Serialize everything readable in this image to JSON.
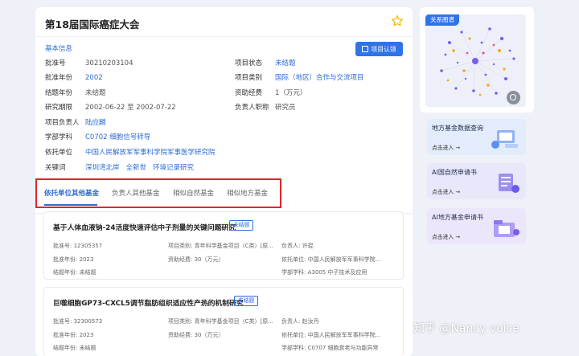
{
  "header": {
    "title": "第18届国际癌症大会"
  },
  "basic": {
    "section_title": "基本信息",
    "project_btn": "项目认领",
    "left": [
      {
        "label": "批准号",
        "value": "30210203104",
        "blue": false
      },
      {
        "label": "批准年份",
        "value": "2002",
        "blue": true
      },
      {
        "label": "结题年份",
        "value": "未结题",
        "blue": false
      },
      {
        "label": "研究期限",
        "value": "2002-06-22 至 2002-07-22",
        "blue": false
      },
      {
        "label": "项目负责人",
        "value": "陆应麟",
        "blue": true
      },
      {
        "label": "学部学科",
        "value": "C0702 细胞信号转导",
        "blue": true
      },
      {
        "label": "依托单位",
        "value": "中国人民解放军军事科学院军事医学研究院",
        "blue": true
      }
    ],
    "right": [
      {
        "label": "项目状态",
        "value": "未结题",
        "blue": true
      },
      {
        "label": "项目类别",
        "value": "国际（地区）合作与交流项目",
        "blue": true
      },
      {
        "label": "资助经费",
        "value": "1（万元）",
        "blue": false
      },
      {
        "label": "负责人职称",
        "value": "研究员",
        "blue": false
      }
    ],
    "keywords_label": "关键词",
    "keywords": [
      "深圳湾北岸",
      "全新世",
      "环境记录研究"
    ]
  },
  "tabs": [
    "依托单位其他基金",
    "负责人其他基金",
    "相似自然基金",
    "相似地方基金"
  ],
  "projects": [
    {
      "title": "基于人体血液钠-24活度快速评估中子剂量的关键问题研究",
      "badge": "未结题",
      "meta": [
        [
          "批准号: 12305357",
          "项目类别: 青年科学基金项目（C类）[原...",
          "负责人: 许琨"
        ],
        [
          "批准年份: 2023",
          "资助经费: 30（万元）",
          "依托单位: 中国人民解放军军事科学院..."
        ],
        [
          "结题年份: 未结题",
          "",
          "学部学科: A3005 中子技术及应用"
        ]
      ]
    },
    {
      "title": "巨噬细胞GP73-CXCL5调节脂肪组织适应性产热的机制研究",
      "badge": "未结题",
      "meta": [
        [
          "批准号: 32300573",
          "项目类别: 青年科学基金项目（C类）[原...",
          "负责人: 赵汝丹"
        ],
        [
          "批准年份: 2023",
          "资助经费: 30（万元）",
          "依托单位: 中国人民解放军军事科学院..."
        ],
        [
          "结题年份: 未结题",
          "",
          "学部学科: C0707 细胞衰老与功能异常"
        ]
      ]
    }
  ],
  "sidebar": {
    "graph_title": "关系图谱",
    "cards": [
      {
        "title": "地方基金数据查询",
        "action": "点击进入 →",
        "bg": "#e3ecfb"
      },
      {
        "title": "AI国自然申请书",
        "action": "点击进入 →",
        "bg": "#e8e8fb"
      },
      {
        "title": "AI地方基金申请书",
        "action": "点击进入 →",
        "bg": "#ece6fb"
      }
    ]
  },
  "watermark": "知乎 @Nancy voice",
  "colors": {
    "accent": "#2d6bd6",
    "button": "#2f74e7",
    "highlight_box": "#e0252f"
  }
}
